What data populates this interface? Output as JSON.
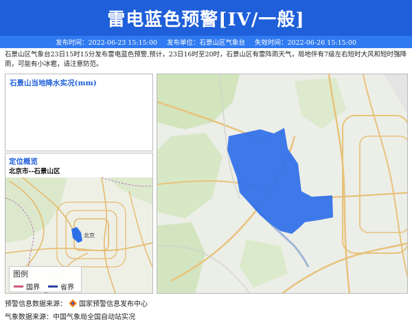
{
  "banner": {
    "title": "雷电蓝色预警[IV/一般]"
  },
  "meta": {
    "publish_time": "发布时间：2022-06-23 15:15:00",
    "publisher": "发布单位：石景山区气象台",
    "expire_time": "失效时间：2022-06-26 15:15:00"
  },
  "description": "石景山区气象台23日15时15分发布雷电蓝色预警,预计，23日16时至20时，石景山区有雷阵雨天气，局地伴有7级左右短时大风和短时强降雨，可能有小冰雹，请注意防范。",
  "rain_panel": {
    "title": "石景山当地降水实况(mm)"
  },
  "location_panel": {
    "title": "定位概览",
    "subtitle": "北京市--石景山区",
    "city_label": "北京"
  },
  "legend": {
    "title": "图例",
    "items": [
      {
        "label": "国界",
        "color": "#c9587a"
      },
      {
        "label": "省界",
        "color": "#2a3fa0"
      }
    ]
  },
  "colors": {
    "banner": "#1f5fd9",
    "meta_bar": "#2f7af0",
    "warning_area": "#2f6fe8",
    "title_blue": "#1f5fd9"
  },
  "icons": {
    "source_logo": "warning-center-logo-icon"
  },
  "sources": {
    "warning_source": "预警信息数据来源：",
    "warning_org": "国家预警信息发布中心",
    "weather_source": "气象数据来源：中国气象局全国自动站实况"
  }
}
